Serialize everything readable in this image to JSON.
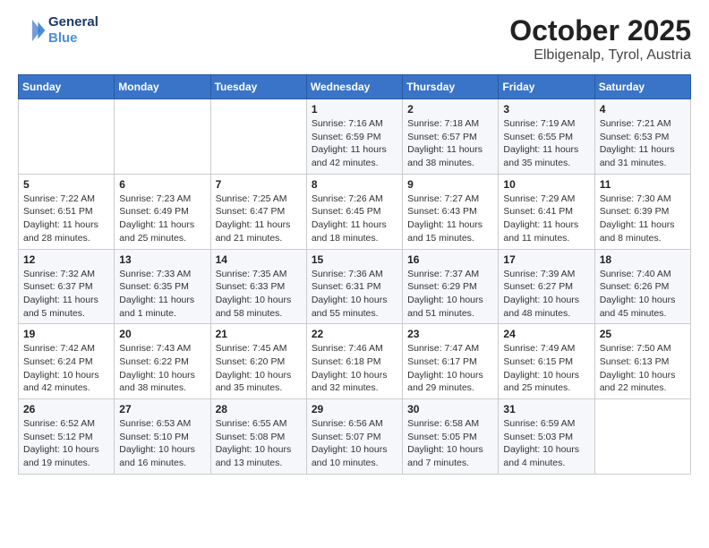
{
  "header": {
    "logo_line1": "General",
    "logo_line2": "Blue",
    "title": "October 2025",
    "subtitle": "Elbigenalp, Tyrol, Austria"
  },
  "days_of_week": [
    "Sunday",
    "Monday",
    "Tuesday",
    "Wednesday",
    "Thursday",
    "Friday",
    "Saturday"
  ],
  "weeks": [
    [
      {
        "day": "",
        "info": ""
      },
      {
        "day": "",
        "info": ""
      },
      {
        "day": "",
        "info": ""
      },
      {
        "day": "1",
        "info": "Sunrise: 7:16 AM\nSunset: 6:59 PM\nDaylight: 11 hours and 42 minutes."
      },
      {
        "day": "2",
        "info": "Sunrise: 7:18 AM\nSunset: 6:57 PM\nDaylight: 11 hours and 38 minutes."
      },
      {
        "day": "3",
        "info": "Sunrise: 7:19 AM\nSunset: 6:55 PM\nDaylight: 11 hours and 35 minutes."
      },
      {
        "day": "4",
        "info": "Sunrise: 7:21 AM\nSunset: 6:53 PM\nDaylight: 11 hours and 31 minutes."
      }
    ],
    [
      {
        "day": "5",
        "info": "Sunrise: 7:22 AM\nSunset: 6:51 PM\nDaylight: 11 hours and 28 minutes."
      },
      {
        "day": "6",
        "info": "Sunrise: 7:23 AM\nSunset: 6:49 PM\nDaylight: 11 hours and 25 minutes."
      },
      {
        "day": "7",
        "info": "Sunrise: 7:25 AM\nSunset: 6:47 PM\nDaylight: 11 hours and 21 minutes."
      },
      {
        "day": "8",
        "info": "Sunrise: 7:26 AM\nSunset: 6:45 PM\nDaylight: 11 hours and 18 minutes."
      },
      {
        "day": "9",
        "info": "Sunrise: 7:27 AM\nSunset: 6:43 PM\nDaylight: 11 hours and 15 minutes."
      },
      {
        "day": "10",
        "info": "Sunrise: 7:29 AM\nSunset: 6:41 PM\nDaylight: 11 hours and 11 minutes."
      },
      {
        "day": "11",
        "info": "Sunrise: 7:30 AM\nSunset: 6:39 PM\nDaylight: 11 hours and 8 minutes."
      }
    ],
    [
      {
        "day": "12",
        "info": "Sunrise: 7:32 AM\nSunset: 6:37 PM\nDaylight: 11 hours and 5 minutes."
      },
      {
        "day": "13",
        "info": "Sunrise: 7:33 AM\nSunset: 6:35 PM\nDaylight: 11 hours and 1 minute."
      },
      {
        "day": "14",
        "info": "Sunrise: 7:35 AM\nSunset: 6:33 PM\nDaylight: 10 hours and 58 minutes."
      },
      {
        "day": "15",
        "info": "Sunrise: 7:36 AM\nSunset: 6:31 PM\nDaylight: 10 hours and 55 minutes."
      },
      {
        "day": "16",
        "info": "Sunrise: 7:37 AM\nSunset: 6:29 PM\nDaylight: 10 hours and 51 minutes."
      },
      {
        "day": "17",
        "info": "Sunrise: 7:39 AM\nSunset: 6:27 PM\nDaylight: 10 hours and 48 minutes."
      },
      {
        "day": "18",
        "info": "Sunrise: 7:40 AM\nSunset: 6:26 PM\nDaylight: 10 hours and 45 minutes."
      }
    ],
    [
      {
        "day": "19",
        "info": "Sunrise: 7:42 AM\nSunset: 6:24 PM\nDaylight: 10 hours and 42 minutes."
      },
      {
        "day": "20",
        "info": "Sunrise: 7:43 AM\nSunset: 6:22 PM\nDaylight: 10 hours and 38 minutes."
      },
      {
        "day": "21",
        "info": "Sunrise: 7:45 AM\nSunset: 6:20 PM\nDaylight: 10 hours and 35 minutes."
      },
      {
        "day": "22",
        "info": "Sunrise: 7:46 AM\nSunset: 6:18 PM\nDaylight: 10 hours and 32 minutes."
      },
      {
        "day": "23",
        "info": "Sunrise: 7:47 AM\nSunset: 6:17 PM\nDaylight: 10 hours and 29 minutes."
      },
      {
        "day": "24",
        "info": "Sunrise: 7:49 AM\nSunset: 6:15 PM\nDaylight: 10 hours and 25 minutes."
      },
      {
        "day": "25",
        "info": "Sunrise: 7:50 AM\nSunset: 6:13 PM\nDaylight: 10 hours and 22 minutes."
      }
    ],
    [
      {
        "day": "26",
        "info": "Sunrise: 6:52 AM\nSunset: 5:12 PM\nDaylight: 10 hours and 19 minutes."
      },
      {
        "day": "27",
        "info": "Sunrise: 6:53 AM\nSunset: 5:10 PM\nDaylight: 10 hours and 16 minutes."
      },
      {
        "day": "28",
        "info": "Sunrise: 6:55 AM\nSunset: 5:08 PM\nDaylight: 10 hours and 13 minutes."
      },
      {
        "day": "29",
        "info": "Sunrise: 6:56 AM\nSunset: 5:07 PM\nDaylight: 10 hours and 10 minutes."
      },
      {
        "day": "30",
        "info": "Sunrise: 6:58 AM\nSunset: 5:05 PM\nDaylight: 10 hours and 7 minutes."
      },
      {
        "day": "31",
        "info": "Sunrise: 6:59 AM\nSunset: 5:03 PM\nDaylight: 10 hours and 4 minutes."
      },
      {
        "day": "",
        "info": ""
      }
    ]
  ]
}
